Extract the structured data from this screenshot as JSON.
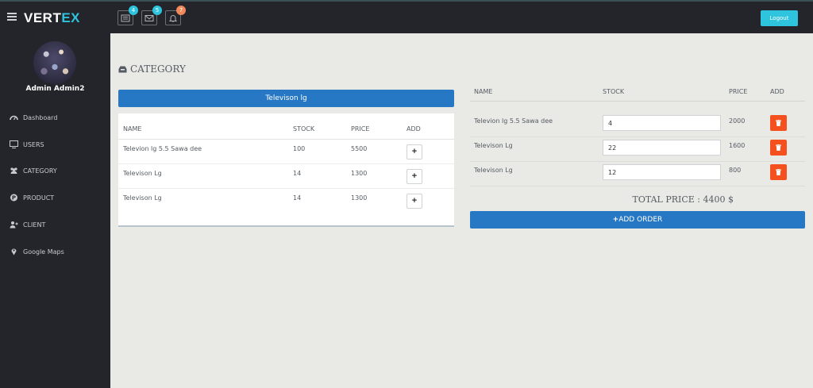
{
  "brand": {
    "name_main": "VERT",
    "name_accent": "EX"
  },
  "header": {
    "badges": [
      {
        "icon": "list-icon",
        "count": "4",
        "color": "#2ec4de"
      },
      {
        "icon": "envelope-icon",
        "count": "5",
        "color": "#2ec4de"
      },
      {
        "icon": "bell-icon",
        "count": "7",
        "color": "#f0885a"
      }
    ],
    "logout_label": "Logout"
  },
  "sidebar": {
    "user_name": "Admin Admin2",
    "items": [
      {
        "icon": "dashboard-icon",
        "label": "Dashboard"
      },
      {
        "icon": "monitor-icon",
        "label": "USERS"
      },
      {
        "icon": "users-icon",
        "label": "CATEGORY"
      },
      {
        "icon": "product-icon",
        "label": "PRODUCT"
      },
      {
        "icon": "add-user-icon",
        "label": "CLIENT"
      },
      {
        "icon": "map-marker-icon",
        "label": "Google Maps"
      }
    ]
  },
  "category": {
    "title": "CATEGORY",
    "selected_button": "Televison lg",
    "columns": {
      "name": "NAME",
      "stock": "STOCK",
      "price": "PRICE",
      "add": "ADD"
    },
    "rows": [
      {
        "name": "Televion lg 5.5 Sawa dee",
        "stock": "100",
        "price": "5500",
        "add": "+"
      },
      {
        "name": "Televison Lg",
        "stock": "14",
        "price": "1300",
        "add": "+"
      },
      {
        "name": "Televison Lg",
        "stock": "14",
        "price": "1300",
        "add": "+"
      }
    ]
  },
  "order": {
    "columns": {
      "name": "NAME",
      "stock": "STOCK",
      "price": "PRICE",
      "add": "ADD"
    },
    "rows": [
      {
        "name": "Televion lg 5.5 Sawa dee",
        "quantity": "4",
        "price": "2000"
      },
      {
        "name": "Televison Lg",
        "quantity": "22",
        "price": "1600"
      },
      {
        "name": "Televison Lg",
        "quantity": "12",
        "price": "800"
      }
    ],
    "total_label": "TOTAL PRICE : 4400 $",
    "add_order_label": "ADD ORDER"
  },
  "colors": {
    "accent": "#2ec4de",
    "primary_button": "#2778c4",
    "danger": "#f4511e",
    "sidebar_bg": "#23252b",
    "content_bg": "#e9e9e6"
  }
}
